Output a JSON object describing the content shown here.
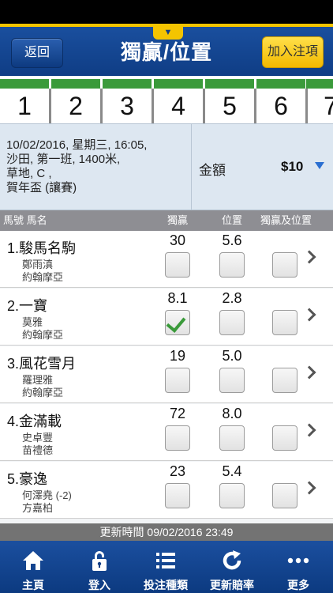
{
  "header": {
    "back_label": "返回",
    "title": "獨贏/位置",
    "add_label": "加入注項",
    "pull_tab_icon": "chevron-down-icon"
  },
  "race_tabs": [
    "1",
    "2",
    "3",
    "4",
    "5",
    "6",
    "7"
  ],
  "race_info": {
    "line1": "10/02/2016, 星期三, 16:05,",
    "line2": "沙田, 第一班, 1400米,",
    "line3": "草地, C ,",
    "line4": "賀年盃 (讓賽)"
  },
  "amount": {
    "label": "金額",
    "value": "$10"
  },
  "columns": {
    "horse": "馬號  馬名",
    "win": "獨贏",
    "place": "位置",
    "win_place": "獨贏及位置"
  },
  "horses": [
    {
      "name": "1.駿馬名駒",
      "jockey": "鄭雨滇",
      "trainer": "約翰摩亞",
      "win": "30",
      "place": "5.6",
      "win_checked": false
    },
    {
      "name": "2.一寶",
      "jockey": "莫雅",
      "trainer": "約翰摩亞",
      "win": "8.1",
      "place": "2.8",
      "win_checked": true
    },
    {
      "name": "3.風花雪月",
      "jockey": "羅理雅",
      "trainer": "約翰摩亞",
      "win": "19",
      "place": "5.0",
      "win_checked": false
    },
    {
      "name": "4.金滿載",
      "jockey": "史卓豐",
      "trainer": "苗禮德",
      "win": "72",
      "place": "8.0",
      "win_checked": false
    },
    {
      "name": "5.豪逸",
      "jockey": "何澤堯 (-2)",
      "trainer": "方嘉柏",
      "win": "23",
      "place": "5.4",
      "win_checked": false
    }
  ],
  "update_time": "更新時間 09/02/2016 23:49",
  "bottom_nav": [
    {
      "label": "主頁",
      "icon": "home-icon"
    },
    {
      "label": "登入",
      "icon": "lock-icon"
    },
    {
      "label": "投注種類",
      "icon": "list-icon"
    },
    {
      "label": "更新賠率",
      "icon": "refresh-icon"
    },
    {
      "label": "更多",
      "icon": "more-icon"
    }
  ],
  "colors": {
    "header_blue": "#0f3d85",
    "accent_yellow": "#f4c400",
    "tab_green": "#3a9a3a",
    "check_green": "#3a9a3a"
  }
}
